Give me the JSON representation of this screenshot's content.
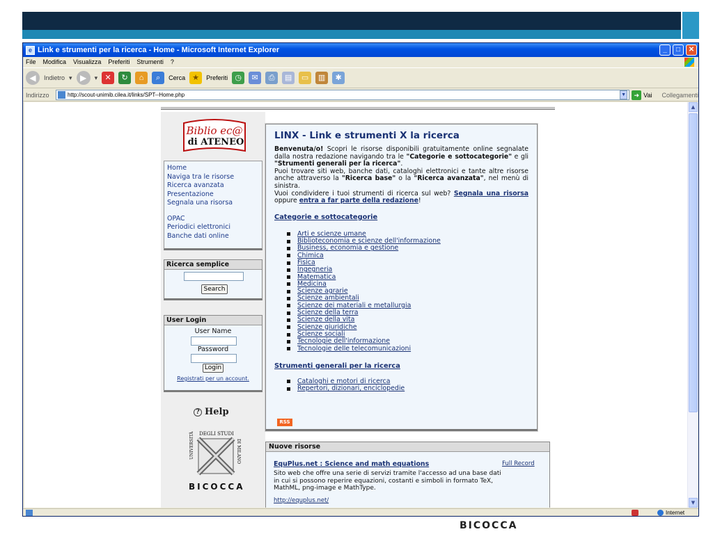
{
  "window": {
    "title": "Link e strumenti per la ricerca - Home - Microsoft Internet Explorer",
    "controls": [
      "minimize",
      "maximize",
      "close"
    ]
  },
  "menubar": {
    "items": [
      "File",
      "Modifica",
      "Visualizza",
      "Preferiti",
      "Strumenti",
      "?"
    ]
  },
  "toolbar": {
    "back_label": "Indietro",
    "search_label": "Cerca",
    "favorites_label": "Preferiti"
  },
  "addressbar": {
    "label": "Indirizzo",
    "url": "http://scout-unimib.cilea.it/links/SPT--Home.php",
    "go_label": "Vai",
    "links_label": "Collegamenti"
  },
  "status": {
    "zone": "Internet"
  },
  "sidebar": {
    "logo_text_top": "Biblio ec@",
    "logo_text_bottom": "di ATENEO",
    "nav": [
      "Home",
      "Naviga tra le risorse",
      "Ricerca avanzata",
      "Presentazione",
      "Segnala una risorsa"
    ],
    "nav2": [
      "OPAC",
      "Periodici elettronici",
      "Banche dati online"
    ],
    "simple_search": {
      "title": "Ricerca semplice",
      "button": "Search",
      "value": ""
    },
    "login": {
      "title": "User Login",
      "user_label": "User Name",
      "password_label": "Password",
      "button": "Login",
      "register": "Registrati per un account."
    },
    "help": "Help",
    "univ_text": "UNIVERSITÀ DEGLI STUDI DI MILANO",
    "univ_name": "BICOCCA"
  },
  "main": {
    "title": "LINX - Link e strumenti X la ricerca",
    "intro": {
      "welcome": "Benvenuta/o!",
      "p1": " Scopri le risorse disponibili gratuitamente online segnalate dalla nostra redazione navigando tra le ",
      "cat_bold": "\"Categorie e sottocategorie\"",
      "p2": " e gli ",
      "tools_bold": "\"Strumenti generali per la ricerca\"",
      "p3": ".",
      "p4": "Puoi trovare siti web, banche dati, cataloghi elettronici e tante altre risorse anche attraverso la ",
      "base_bold": "\"Ricerca base\"",
      "p5": " o la ",
      "adv_bold": "\"Ricerca avanzata\"",
      "p6": ", nel menù di sinistra.",
      "p7": "Vuoi condividere i tuoi strumenti di ricerca sul web? ",
      "link1": "Segnala una risorsa",
      "p8": " oppure ",
      "link2": "entra a far parte della redazione",
      "p9": "!"
    },
    "categories_heading": "Categorie e sottocategorie",
    "categories": [
      "Arti e scienze umane",
      "Biblioteconomia e scienze dell'informazione",
      "Business, economia e gestione",
      "Chimica",
      "Fisica",
      "Ingegneria",
      "Matematica",
      "Medicina",
      "Scienze agrarie",
      "Scienze ambientali",
      "Scienze dei materiali e metallurgia",
      "Scienze della terra",
      "Scienze della vita",
      "Scienze giuridiche",
      "Scienze sociali",
      "Tecnologie dell'informazione",
      "Tecnologie delle telecomunicazioni"
    ],
    "tools_heading": "Strumenti generali per la ricerca",
    "tools": [
      "Cataloghi e motori di ricerca",
      "Repertori, dizionari, enciclopedie"
    ],
    "rss": "RSS"
  },
  "news": {
    "title": "Nuove risorse",
    "item_title": "EquPlus.net : Science and math equations",
    "full_record": "Full Record",
    "description": "Sito web che offre una serie di servizi tramite l'accesso ad una base dati in cui si possono reperire equazioni, costanti e simboli in formato TeX, MathML, png-image e MathType.",
    "url": "http://equplus.net/"
  },
  "footer": {
    "bicocca": "BICOCCA"
  }
}
